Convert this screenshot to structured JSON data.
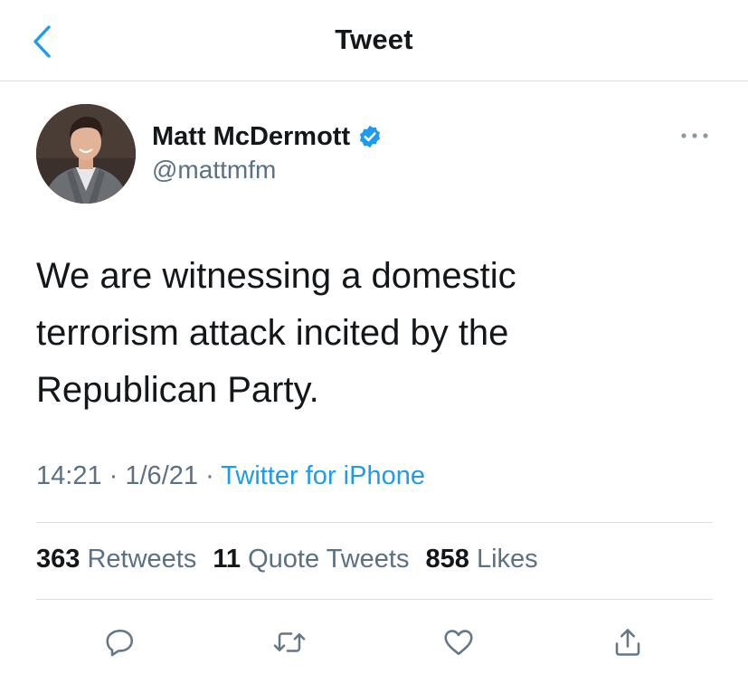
{
  "header": {
    "title": "Tweet",
    "back_icon": "chevron-left-icon"
  },
  "author": {
    "name": "Matt McDermott",
    "handle": "@mattmfm",
    "verified": true,
    "verified_color": "#1d9bf0"
  },
  "tweet": {
    "text": "We are witnessing a domestic terrorism attack incited by the Republican Party.",
    "time": "14:21",
    "date": "1/6/21",
    "separator": "·",
    "source": "Twitter for iPhone"
  },
  "stats": [
    {
      "count": "363",
      "label": "Retweets"
    },
    {
      "count": "11",
      "label": "Quote Tweets"
    },
    {
      "count": "858",
      "label": "Likes"
    }
  ],
  "actions": [
    {
      "name": "reply",
      "icon": "speech-bubble-icon"
    },
    {
      "name": "retweet",
      "icon": "retweet-icon"
    },
    {
      "name": "like",
      "icon": "heart-icon"
    },
    {
      "name": "share",
      "icon": "share-icon"
    }
  ],
  "colors": {
    "accent": "#1d9bf0",
    "text_primary": "#14171a",
    "text_secondary": "#5b7083",
    "divider": "#d9dde1"
  }
}
